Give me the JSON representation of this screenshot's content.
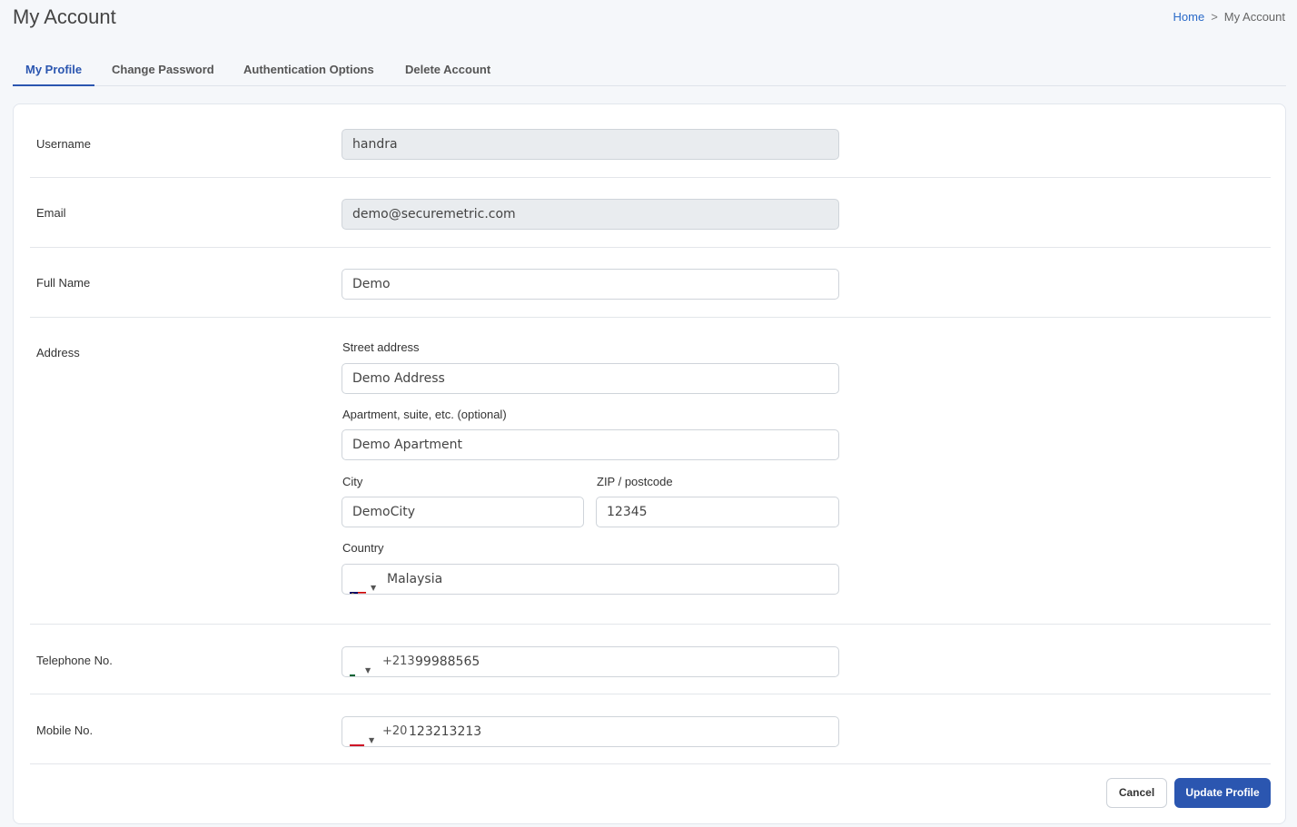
{
  "header": {
    "title": "My Account",
    "breadcrumb": {
      "home": "Home",
      "separator": ">",
      "current": "My Account"
    }
  },
  "tabs": [
    {
      "label": "My Profile",
      "active": true
    },
    {
      "label": "Change Password",
      "active": false
    },
    {
      "label": "Authentication Options",
      "active": false
    },
    {
      "label": "Delete Account",
      "active": false
    }
  ],
  "form": {
    "username": {
      "label": "Username",
      "value": "handra",
      "disabled": true
    },
    "email": {
      "label": "Email",
      "value": "demo@securemetric.com",
      "disabled": true
    },
    "full_name": {
      "label": "Full Name",
      "value": "Demo"
    },
    "address": {
      "label": "Address",
      "street_label": "Street address",
      "street_value": "Demo Address",
      "apartment_label": "Apartment, suite, etc. (optional)",
      "apartment_value": "Demo Apartment",
      "city_label": "City",
      "city_value": "DemoCity",
      "zip_label": "ZIP / postcode",
      "zip_value": "12345",
      "country_label": "Country",
      "country_value": "Malaysia",
      "country_flag_icon": "malaysia-flag-icon"
    },
    "telephone": {
      "label": "Telephone No.",
      "dial_code": "+213",
      "value": "99988565",
      "flag_icon": "algeria-flag-icon"
    },
    "mobile": {
      "label": "Mobile No.",
      "dial_code": "+20",
      "value": "123213213",
      "flag_icon": "egypt-flag-icon"
    }
  },
  "actions": {
    "cancel_label": "Cancel",
    "submit_label": "Update Profile"
  },
  "colors": {
    "accent": "#2b56b0",
    "link": "#2a6ac8",
    "disabled_field": "#e9ecef"
  }
}
